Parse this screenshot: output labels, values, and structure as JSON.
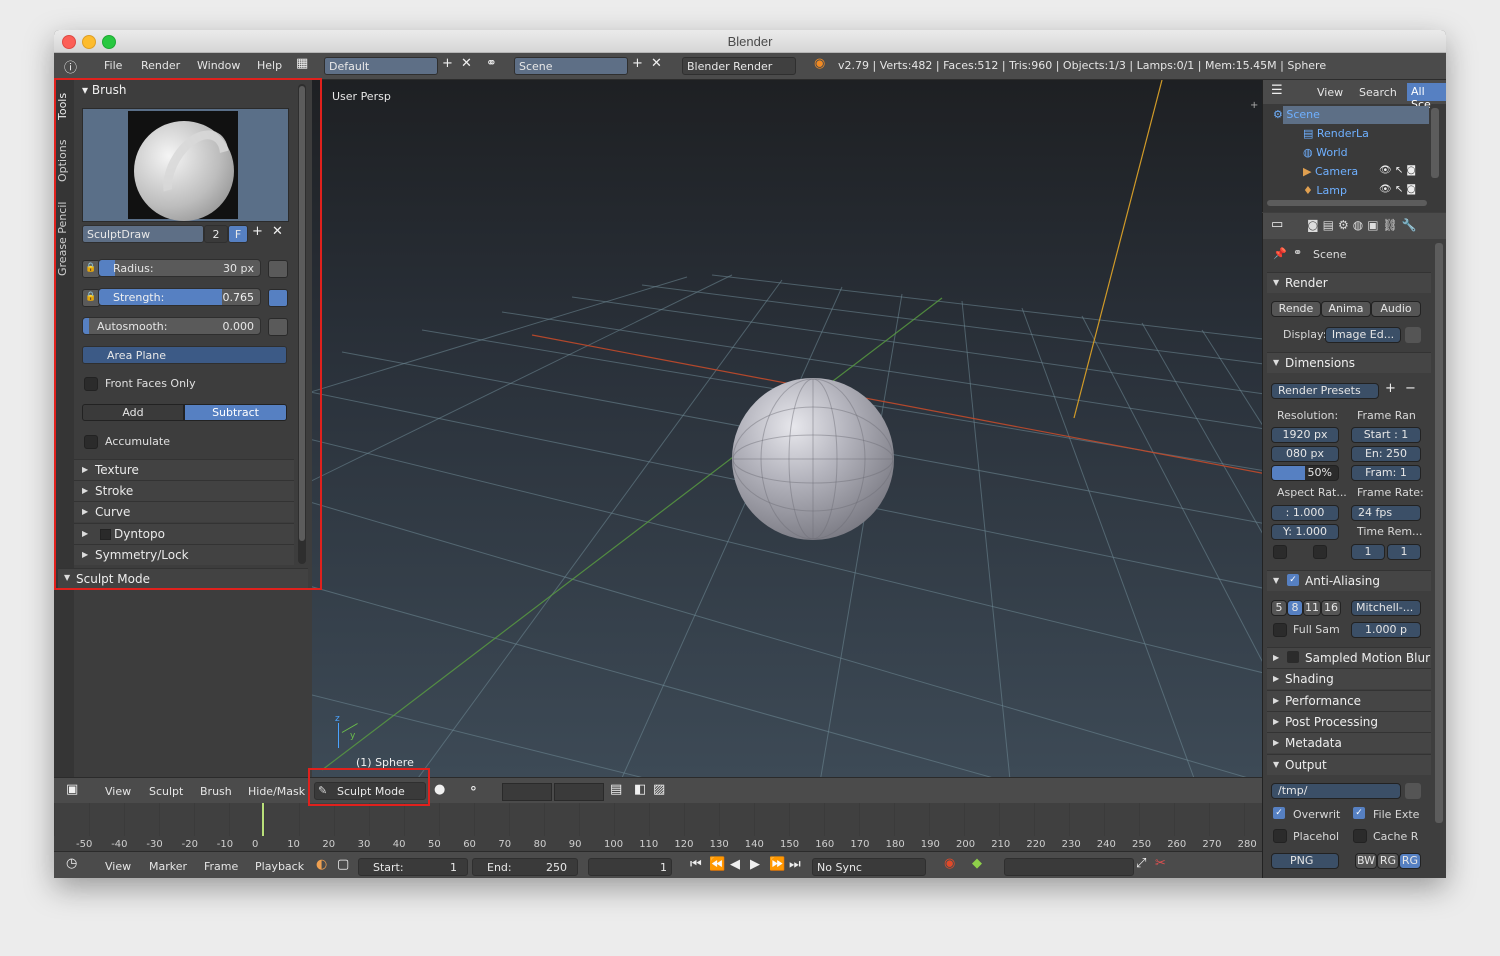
{
  "window": {
    "title": "Blender"
  },
  "menubar": {
    "menus": [
      "File",
      "Render",
      "Window",
      "Help"
    ],
    "layout": "Default",
    "scene": "Scene",
    "engine": "Blender Render",
    "stats": "v2.79 | Verts:482 | Faces:512 | Tris:960 | Objects:1/3 | Lamps:0/1 | Mem:15.45M | Sphere"
  },
  "shelf": {
    "tabs": [
      "Tools",
      "Options",
      "Grease Pencil"
    ],
    "brush_header": "Brush",
    "brush_name": "SculptDraw",
    "brush_users": "2",
    "brush_fake": "F",
    "radius_label": "Radius:",
    "radius_value": "30 px",
    "strength_label": "Strength:",
    "strength_value": "0.765",
    "strength_level": 0.765,
    "autosmooth_label": "Autosmooth:",
    "autosmooth_value": "0.000",
    "area_plane": "Area Plane",
    "front_faces": "Front Faces Only",
    "add": "Add",
    "subtract": "Subtract",
    "accumulate": "Accumulate",
    "subpanels": [
      "Texture",
      "Stroke",
      "Curve",
      "Dyntopo",
      "Symmetry/Lock"
    ],
    "sculpt_mode_header": "Sculpt Mode"
  },
  "viewport": {
    "view_label": "User Persp",
    "object_label": "(1) Sphere",
    "axis_z": "z",
    "axis_y": "y"
  },
  "view_header": {
    "menus": [
      "View",
      "Sculpt",
      "Brush",
      "Hide/Mask"
    ],
    "mode": "Sculpt Mode"
  },
  "timeline": {
    "ticks": [
      "-50",
      "-40",
      "-30",
      "-20",
      "-10",
      "0",
      "10",
      "20",
      "30",
      "40",
      "50",
      "60",
      "70",
      "80",
      "90",
      "100",
      "110",
      "120",
      "130",
      "140",
      "150",
      "160",
      "170",
      "180",
      "190",
      "200",
      "210",
      "220",
      "230",
      "240",
      "250",
      "260",
      "270",
      "280"
    ],
    "menus": [
      "View",
      "Marker",
      "Frame",
      "Playback"
    ],
    "start_label": "Start:",
    "start_value": "1",
    "end_label": "End:",
    "end_value": "250",
    "current_frame": "1",
    "sync": "No Sync"
  },
  "outliner": {
    "menus": [
      "View",
      "Search",
      "All Sce"
    ],
    "items": [
      "Scene",
      "RenderLa",
      "World",
      "Camera",
      "Lamp"
    ]
  },
  "properties": {
    "context": "Scene",
    "render_header": "Render",
    "render_btn": "Rende",
    "anim_btn": "Anima",
    "audio_btn": "Audio",
    "display_label": "Display:",
    "display_value": "Image Ed...",
    "dimensions_header": "Dimensions",
    "render_presets": "Render Presets",
    "resolution_label": "Resolution:",
    "frame_range_label": "Frame Ran",
    "res_x": "1920 px",
    "res_y": "080 px",
    "res_pct": "50%",
    "frame_start": "Start : 1",
    "frame_end": "En: 250",
    "frame_step": "Fram: 1",
    "aspect_label": "Aspect Rat...",
    "frame_rate_label": "Frame Rate:",
    "aspect_x": ": 1.000",
    "aspect_y": "Y: 1.000",
    "fps": "24 fps",
    "time_remap_label": "Time Rem...",
    "remap_old": "1",
    "remap_new": "1",
    "aa_header": "Anti-Aliasing",
    "aa_samples": [
      "5",
      "8",
      "11",
      "16"
    ],
    "aa_filter": "Mitchell-...",
    "full_sample": "Full Sam",
    "filter_size": "1.000 p",
    "motion_blur": "Sampled Motion Blur",
    "collapsed": [
      "Shading",
      "Performance",
      "Post Processing",
      "Metadata"
    ],
    "output_header": "Output",
    "output_path": "/tmp/",
    "overwrite": "Overwrit",
    "file_ext": "File Exte",
    "placeholders": "Placehol",
    "cache": "Cache R",
    "format": "PNG",
    "color_modes": [
      "BW",
      "RG",
      "RG"
    ]
  }
}
